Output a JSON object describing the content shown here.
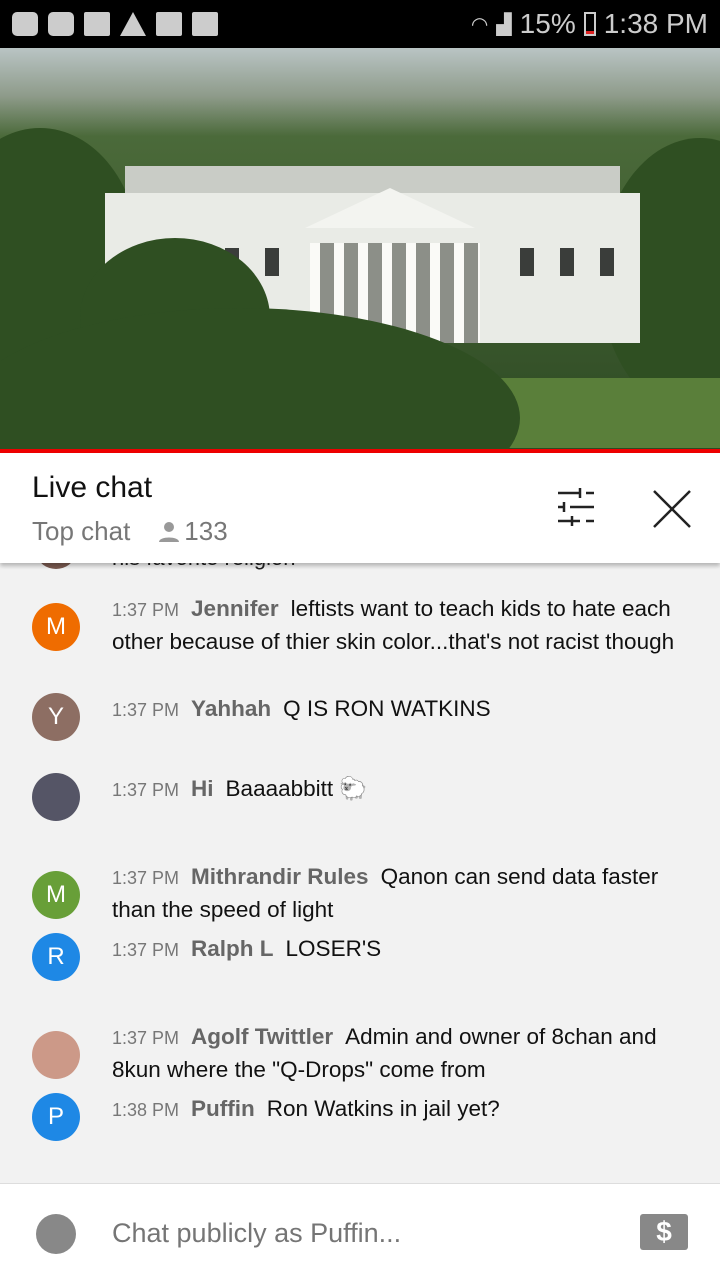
{
  "status_bar": {
    "battery": "15%",
    "time": "1:38 PM",
    "icons": [
      "app-icon",
      "youtube-icon",
      "folder-icon",
      "warning-icon",
      "image-icon",
      "news-icon",
      "wifi-icon",
      "signal-icon",
      "battery-icon"
    ]
  },
  "header": {
    "title": "Live chat",
    "mode": "Top chat",
    "viewers": "133"
  },
  "partial_message": "his favorite religion",
  "messages": [
    {
      "time": "1:37 PM",
      "author": "Jennifer",
      "text": "leftists want to teach kids to hate each other because of thier skin color...that's not racist though",
      "initial": "M",
      "color": "#ef6c00"
    },
    {
      "time": "1:37 PM",
      "author": "Yahhah",
      "text": "Q IS RON WATKINS",
      "initial": "Y",
      "color": "#8d6e63"
    },
    {
      "time": "1:37 PM",
      "author": "Hi",
      "text": "Baaaabbitt",
      "initial": "",
      "color": "#556",
      "emoji": "sheep-emoji"
    },
    {
      "time": "1:37 PM",
      "author": "Mithrandir Rules",
      "text": "Qanon can send data faster than the speed of light",
      "initial": "M",
      "color": "#689f38"
    },
    {
      "time": "1:37 PM",
      "author": "Ralph L",
      "text": "LOSER'S",
      "initial": "R",
      "color": "#1e88e5"
    },
    {
      "time": "1:37 PM",
      "author": "Agolf Twittler",
      "text": "Admin and owner of 8chan and 8kun where the \"Q-Drops\" come from",
      "initial": "",
      "color": "#c98"
    },
    {
      "time": "1:38 PM",
      "author": "Puffin",
      "text": "Ron Watkins in jail yet?",
      "initial": "P",
      "color": "#1e88e5"
    }
  ],
  "input": {
    "placeholder": "Chat publicly as Puffin..."
  },
  "colors": {
    "accent": "#e00000",
    "chat_bg": "#f2f2f2"
  }
}
